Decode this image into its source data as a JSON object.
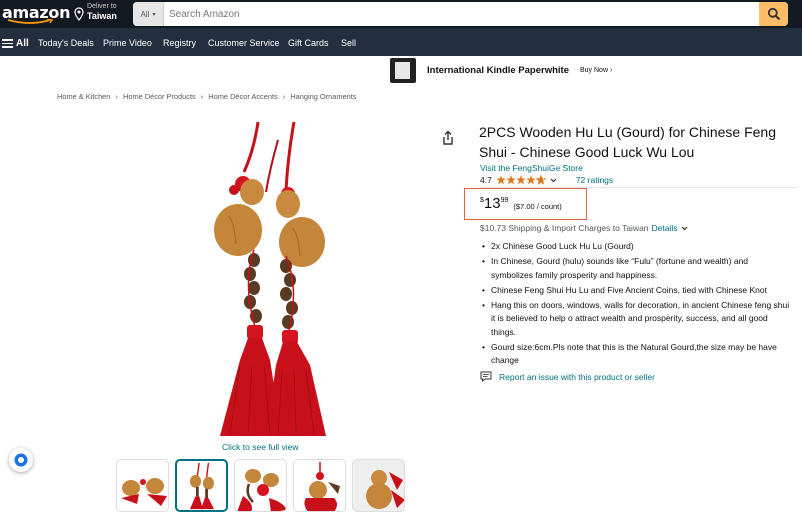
{
  "header": {
    "logo_text": "amazon",
    "deliver_line1": "Deliver to",
    "deliver_line2": "Taiwan",
    "search_category": "All",
    "search_placeholder": "Search Amazon"
  },
  "nav": {
    "all_label": "All",
    "items": [
      "Today's Deals",
      "Prime Video",
      "Registry",
      "Customer Service",
      "Gift Cards",
      "Sell"
    ]
  },
  "ad": {
    "title": "International Kindle Paperwhite",
    "cta": "Buy Now ›"
  },
  "breadcrumb": [
    "Home & Kitchen",
    "Home Décor Products",
    "Home Décor Accents",
    "Hanging Ornaments"
  ],
  "breadcrumb_separator": "›",
  "gallery": {
    "full_view_label": "Click to see full view",
    "thumbnail_count": 5,
    "selected_thumbnail": 2
  },
  "product": {
    "title": "2PCS Wooden Hu Lu (Gourd) for Chinese Feng Shui - Chinese Good Luck Wu Lou",
    "store_link": "Visit the FengShuiGe Store",
    "rating_value": "4.7",
    "stars": 4.7,
    "ratings_count": "72 ratings",
    "price_symbol": "$",
    "price_whole": "13",
    "price_fraction": "99",
    "price_per_unit": "($7.00 / count)",
    "shipping_text": "$10.73 Shipping & Import Charges to Taiwan",
    "shipping_details_link": "Details",
    "bullets": [
      "2x Chinese Good Luck Hu Lu (Gourd)",
      "In Chinese, Gourd (hulu) sounds like “Fulu” (fortune and wealth) and symbolizes family prosperity and happiness.",
      "Chinese Feng Shui Hu Lu and Five Ancient Coins, tied with Chinese Knot",
      "Hang this on doors, windows, walls for decoration, in ancient Chinese feng shui it is believed to help o attract wealth and prosperity, success, and all good things.",
      "Gourd size:6cm.Pls note that this is the Natural Gourd,the size may be have change"
    ],
    "report_link": "Report an issue with this product or seller"
  },
  "colors": {
    "header_bg": "#131921",
    "nav_bg": "#232f3e",
    "search_button": "#febd69",
    "link": "#007185",
    "star": "#de7921",
    "highlight_box": "#e8623d",
    "tassel_red": "#c8101a",
    "gourd": "#c98a40"
  },
  "icons": [
    "location-pin-icon",
    "search-icon",
    "menu-icon",
    "share-icon",
    "chevron-down-icon",
    "report-icon",
    "assistant-icon"
  ]
}
